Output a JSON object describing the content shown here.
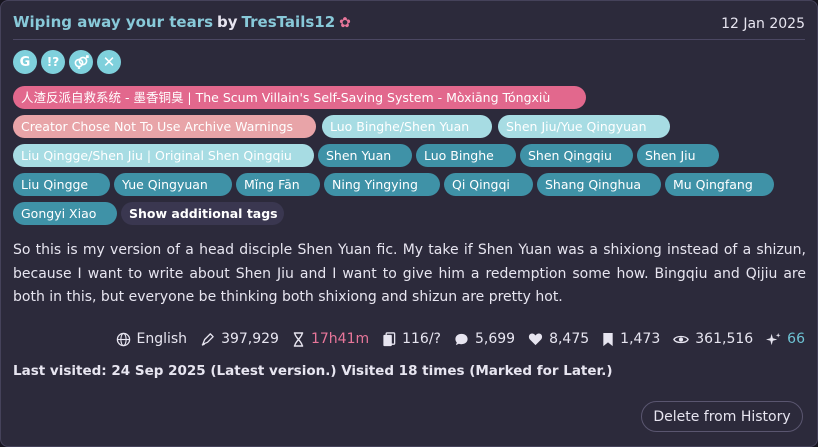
{
  "work": {
    "title": "Wiping away your tears",
    "by": "by",
    "author": "TresTails12",
    "author_flower": "✿",
    "date": "12 Jan 2025"
  },
  "required_icons": [
    {
      "name": "rating-general-icon",
      "glyph": "G"
    },
    {
      "name": "warning-choose-not-icon",
      "glyph": "!?"
    },
    {
      "name": "category-multi-icon",
      "glyph": "⚥"
    },
    {
      "name": "incomplete-icon",
      "glyph": "✕"
    }
  ],
  "tags": {
    "fandom": "人渣反派自救系统 - 墨香铜臭 | The Scum Villain's Self-Saving System - Mòxiāng Tóngxiù",
    "warning": "Creator Chose Not To Use Archive Warnings",
    "relationships": [
      "Luo Binghe/Shen Yuan",
      "Shen Jiu/Yue Qingyuan",
      "Liu Qingge/Shen Jiu | Original Shen Qingqiu"
    ],
    "characters": [
      "Shen Yuan",
      "Luo Binghe",
      "Shen Qingqiu",
      "Shen Jiu",
      "Liu Qingge",
      "Yue Qingyuan",
      "Mǐng Fān",
      "Ning Yingying",
      "Qi Qingqi",
      "Shang Qinghua",
      "Mu Qingfang",
      "Gongyi Xiao"
    ],
    "show_more": "Show additional tags"
  },
  "summary": "So this is my version of a head disciple Shen Yuan fic. My take if Shen Yuan was a shixiong instead of a shizun, because I want to write about Shen Jiu and I want to give him a redemption some how. Bingqiu and Qijiu are both in this, but everyone be thinking both shixiong and shizun are pretty hot.",
  "stats": {
    "language": "English",
    "words": "397,929",
    "reading_time": "17h41m",
    "chapters": "116/?",
    "comments": "5,699",
    "kudos": "8,475",
    "bookmarks": "1,473",
    "hits": "361,516",
    "score": "66"
  },
  "visited": "Last visited: 24 Sep 2025 (Latest version.) Visited 18 times (Marked for Later.)",
  "delete_button": "Delete from History"
}
